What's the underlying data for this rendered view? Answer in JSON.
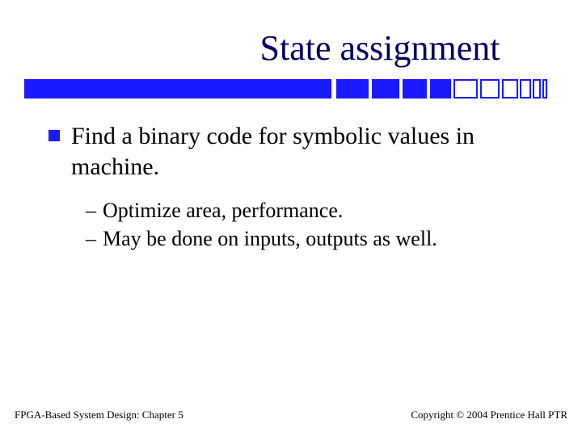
{
  "title": "State assignment",
  "bullets": {
    "main": "Find a binary code for symbolic values in machine.",
    "sub": [
      "Optimize area, performance.",
      "May be done on inputs, outputs as well."
    ]
  },
  "footer": {
    "left": "FPGA-Based System Design: Chapter 5",
    "right": "Copyright © 2004 Prentice Hall PTR"
  }
}
